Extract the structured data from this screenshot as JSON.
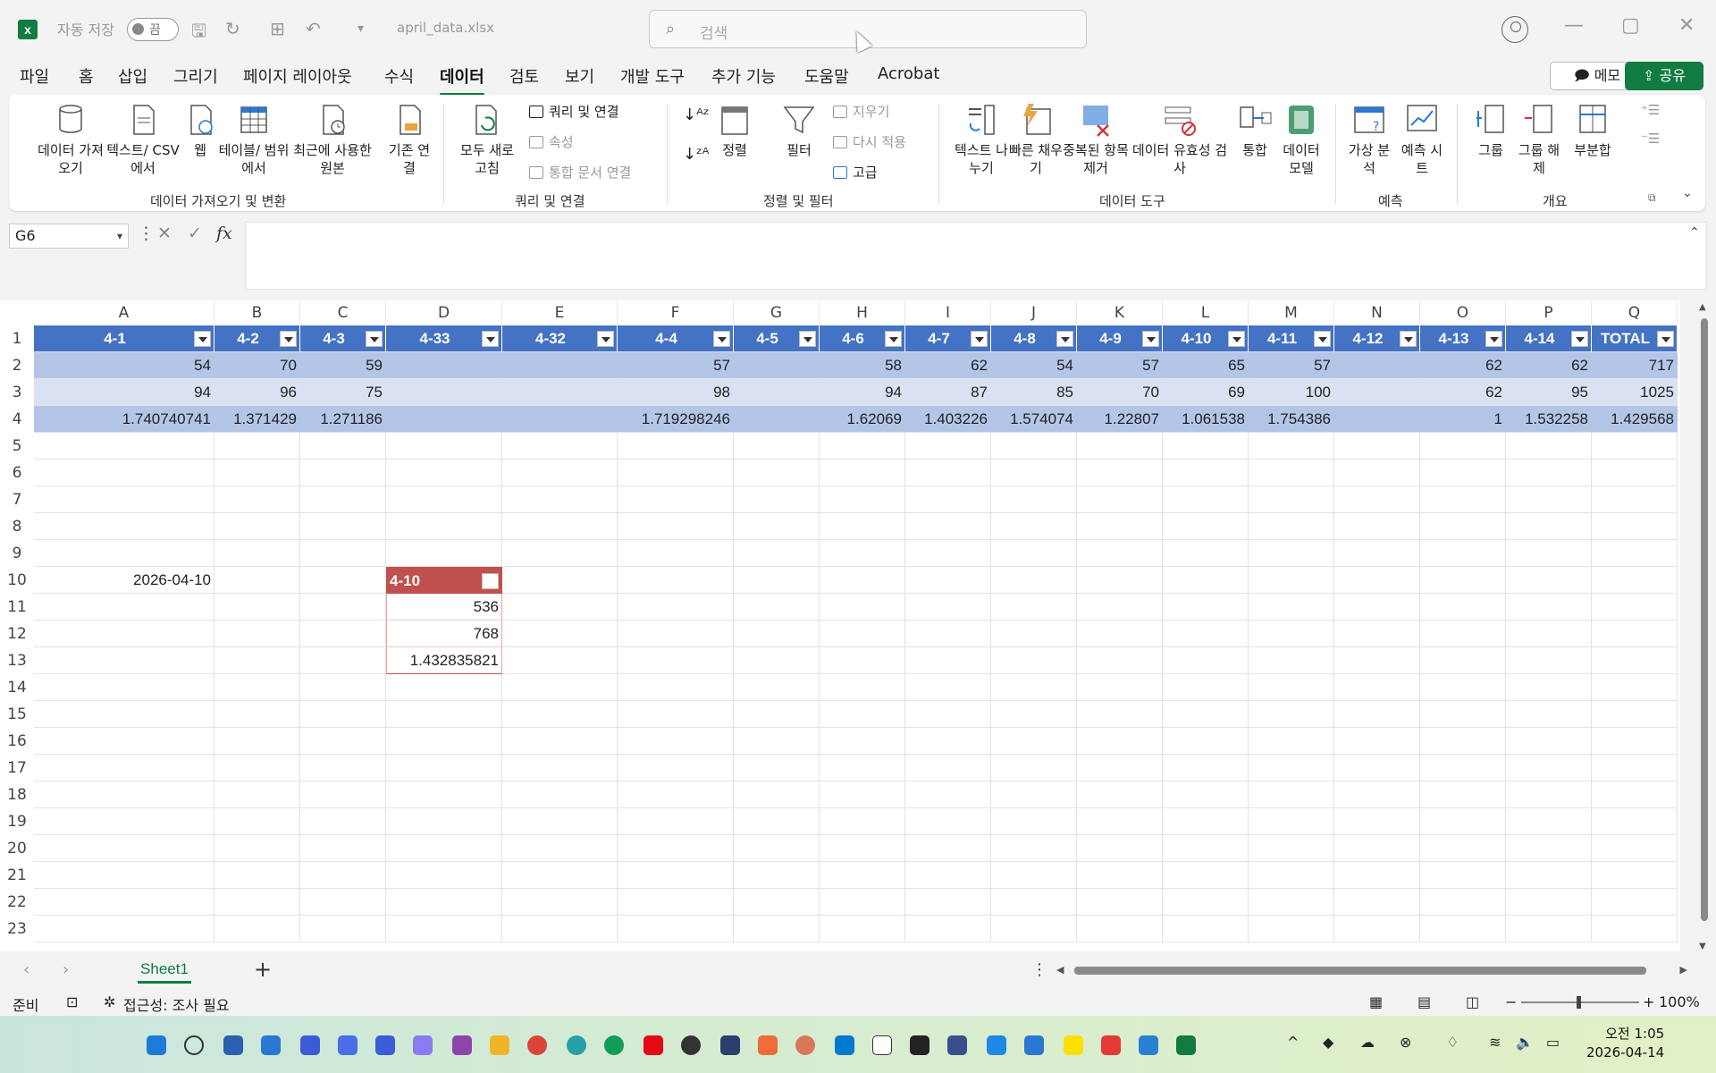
{
  "titlebar": {
    "autosave_label": "자동 저장",
    "toggle_state": "끔",
    "filename": "april_data.xlsx",
    "search_placeholder": "검색"
  },
  "menu": {
    "tabs": [
      "파일",
      "홈",
      "삽입",
      "그리기",
      "페이지 레이아웃",
      "수식",
      "데이터",
      "검토",
      "보기",
      "개발 도구",
      "추가 기능",
      "도움말",
      "Acrobat"
    ],
    "active": "데이터",
    "memo_label": "메모",
    "share_label": "공유"
  },
  "ribbon": {
    "get_data": "데이터 가져오기",
    "text_csv": "텍스트/ CSV에서",
    "web": "웹",
    "table_range": "테이블/ 범위에서",
    "recent_sources": "최근에 사용한 원본",
    "existing_conn": "기존 연결",
    "refresh_all": "모두 새로 고침",
    "queries_conn": "쿼리 및 연결",
    "properties": "속성",
    "edit_links": "통합 문서 연결",
    "sort_label": "정렬",
    "filter_label": "필터",
    "clear_label": "지우기",
    "reapply_label": "다시 적용",
    "advanced_label": "고급",
    "text_to_col": "텍스트 나누기",
    "flash_fill": "빠른 채우기",
    "remove_dup": "중복된 항목 제거",
    "data_validation": "데이터 유효성 검사",
    "consolidate": "통합",
    "data_model": "데이터 모델",
    "whatif": "가상 분석",
    "forecast_sheet": "예측 시트",
    "group": "그룹",
    "ungroup": "그룹 해제",
    "subtotal": "부분합",
    "group_labels": [
      "데이터 가져오기 및 변환",
      "쿼리 및 연결",
      "정렬 및 필터",
      "데이터 도구",
      "예측",
      "개요"
    ]
  },
  "formula_bar": {
    "name_box": "G6",
    "fx": "fx",
    "formula": ""
  },
  "sheet": {
    "columns": [
      "A",
      "B",
      "C",
      "D",
      "E",
      "F",
      "G",
      "H",
      "I",
      "J",
      "K",
      "L",
      "M",
      "N",
      "O",
      "P",
      "Q"
    ],
    "row_numbers": [
      "1",
      "2",
      "3",
      "4",
      "5",
      "6",
      "7",
      "8",
      "9",
      "10",
      "11",
      "12",
      "13",
      "14",
      "15",
      "16",
      "17",
      "18",
      "19",
      "20",
      "21",
      "22",
      "23"
    ],
    "table1_headers": [
      "4-1",
      "4-2",
      "4-3",
      "4-33",
      "4-32",
      "4-4",
      "4-5",
      "4-6",
      "4-7",
      "4-8",
      "4-9",
      "4-10",
      "4-11",
      "4-12",
      "4-13",
      "4-14",
      "TOTAL"
    ],
    "table1_rows": [
      [
        "54",
        "70",
        "59",
        "",
        "",
        "57",
        "",
        "58",
        "62",
        "54",
        "57",
        "65",
        "57",
        "",
        "62",
        "62",
        "717"
      ],
      [
        "94",
        "96",
        "75",
        "",
        "",
        "98",
        "",
        "94",
        "87",
        "85",
        "70",
        "69",
        "100",
        "",
        "62",
        "95",
        "1025"
      ],
      [
        "1.740740741",
        "1.371429",
        "1.271186",
        "",
        "",
        "1.719298246",
        "",
        "1.62069",
        "1.403226",
        "1.574074",
        "1.22807",
        "1.061538",
        "1.754386",
        "",
        "1",
        "1.532258",
        "1.429568"
      ]
    ],
    "date_cell": "2026-04-10",
    "table2_header": "4-10",
    "table2_values": [
      "536",
      "768",
      "1.432835821"
    ],
    "tab_name": "Sheet1",
    "colors": {
      "header_blue": "#4472c4",
      "band_dark": "#b4c6e7",
      "band_light": "#d9e1f2",
      "header_red": "#c0504d",
      "accent_green": "#107c41"
    }
  },
  "status": {
    "ready": "준비",
    "accessibility": "접근성: 조사 필요",
    "zoom": "100%"
  },
  "taskbar": {
    "time": "오전 1:05",
    "date": "2026-04-14"
  }
}
